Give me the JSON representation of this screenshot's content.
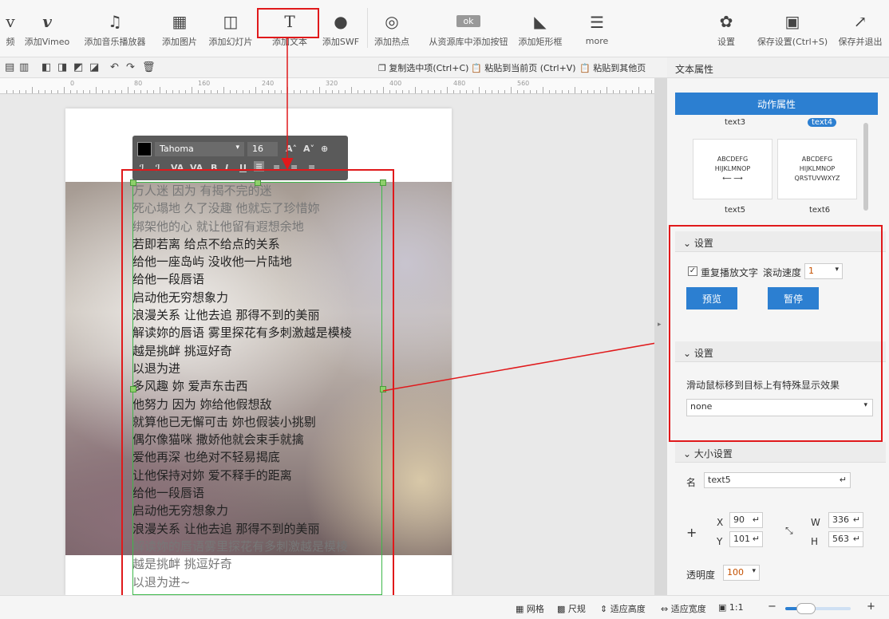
{
  "toolbar": {
    "items": [
      {
        "icon": "video-icon",
        "glyph": "v",
        "label": "频"
      },
      {
        "icon": "vimeo-icon",
        "glyph": "v",
        "label": "添加Vimeo"
      },
      {
        "icon": "music-icon",
        "glyph": "♫",
        "label": "添加音乐播放器"
      },
      {
        "icon": "image-icon",
        "glyph": "▦",
        "label": "添加图片"
      },
      {
        "icon": "slideshow-icon",
        "glyph": "◫",
        "label": "添加幻灯片"
      },
      {
        "icon": "text-icon",
        "glyph": "T",
        "label": "添加文本"
      },
      {
        "icon": "swf-icon",
        "glyph": "●",
        "label": "添加SWF"
      },
      {
        "icon": "hotspot-icon",
        "glyph": "◎",
        "label": "添加热点"
      },
      {
        "icon": "ok-button-icon",
        "glyph": "ok",
        "label": "从资源库中添加按钮"
      },
      {
        "icon": "rectangle-icon",
        "glyph": "◣",
        "label": "添加矩形框"
      },
      {
        "icon": "more-icon",
        "glyph": "☰",
        "label": "more"
      },
      {
        "icon": "gear-icon",
        "glyph": "✿",
        "label": "设置"
      },
      {
        "icon": "save-icon",
        "glyph": "▣",
        "label": "保存设置(Ctrl+S)"
      },
      {
        "icon": "save-exit-icon",
        "glyph": "↗",
        "label": "保存并退出"
      }
    ]
  },
  "edit": {
    "copy": "复制选中项(Ctrl+C)",
    "paste_here": "粘贴到当前页 (Ctrl+V)",
    "paste_other": "粘贴到其他页"
  },
  "ruler": {
    "ticks": [
      "0",
      "80",
      "160",
      "240",
      "320",
      "400",
      "480",
      "560"
    ]
  },
  "format_bar": {
    "font": "Tahoma",
    "size": "16",
    "buttons": [
      "A˄",
      "A˅",
      "⊕"
    ],
    "row2": [
      "ℐ",
      "ℐ",
      "VA",
      "VA",
      "B",
      "I",
      "U",
      "≡",
      "≡",
      "≡",
      "≡"
    ]
  },
  "text_lines": [
    "万人迷 因为 有揭不完的迷",
    "死心塌地 久了没趣 他就忘了珍惜妳",
    "绑架他的心 就让他留有遐想余地",
    "若即若离 给点不给点的关系",
    "给他一座岛屿 没收他一片陆地",
    "给他一段唇语",
    "启动他无穷想象力",
    "浪漫关系 让他去追 那得不到的美丽",
    "解读妳的唇语 雾里探花有多刺激越是模棱",
    "越是挑衅 挑逗好奇",
    "以退为进",
    "多风趣 妳 爱声东击西",
    "他努力 因为 妳给他假想敌",
    "就算他已无懈可击 妳也假装小挑剔",
    "偶尔像猫咪 撒娇他就会束手就擒",
    "爱他再深 也绝对不轻易揭底",
    "让他保持对妳 爱不释手的距离",
    "给他一段唇语",
    "启动他无穷想象力",
    "浪漫关系 让他去追 那得不到的美丽",
    "解读妳的唇语雾里探花有多刺激越是模棱",
    "越是挑衅 挑逗好奇",
    "以退为进~"
  ],
  "panel": {
    "title": "文本属性",
    "action_btn": "动作属性",
    "thumbs": {
      "top_left": "text3",
      "top_right": "text4",
      "thumb1": "ABCDEFG\nHIJKLMNOP\n⟵ ⟶",
      "thumb2": "ABCDEFG\nHIJKLMNOP\nQRSTUVWXYZ",
      "bottom_left": "text5",
      "bottom_right": "text6"
    },
    "settings1": {
      "title": "设置",
      "repeat_label": "重复播放文字",
      "speed_label": "滚动速度",
      "speed_value": "1",
      "preview": "预览",
      "pause": "暂停"
    },
    "settings2": {
      "title": "设置",
      "hover_desc": "滑动鼠标移到目标上有特殊显示效果",
      "effect_value": "none"
    },
    "size": {
      "title": "大小设置",
      "name_label": "名",
      "name_value": "text5",
      "x_label": "X",
      "x_value": "90",
      "y_label": "Y",
      "y_value": "101",
      "w_label": "W",
      "w_value": "336",
      "h_label": "H",
      "h_value": "563",
      "opacity_label": "透明度",
      "opacity_value": "100"
    }
  },
  "status": {
    "grid": "网格",
    "ruler": "尺规",
    "fit_height": "适应高度",
    "fit_width": "适应宽度",
    "ratio": "1:1",
    "minus": "−",
    "plus": "+"
  }
}
